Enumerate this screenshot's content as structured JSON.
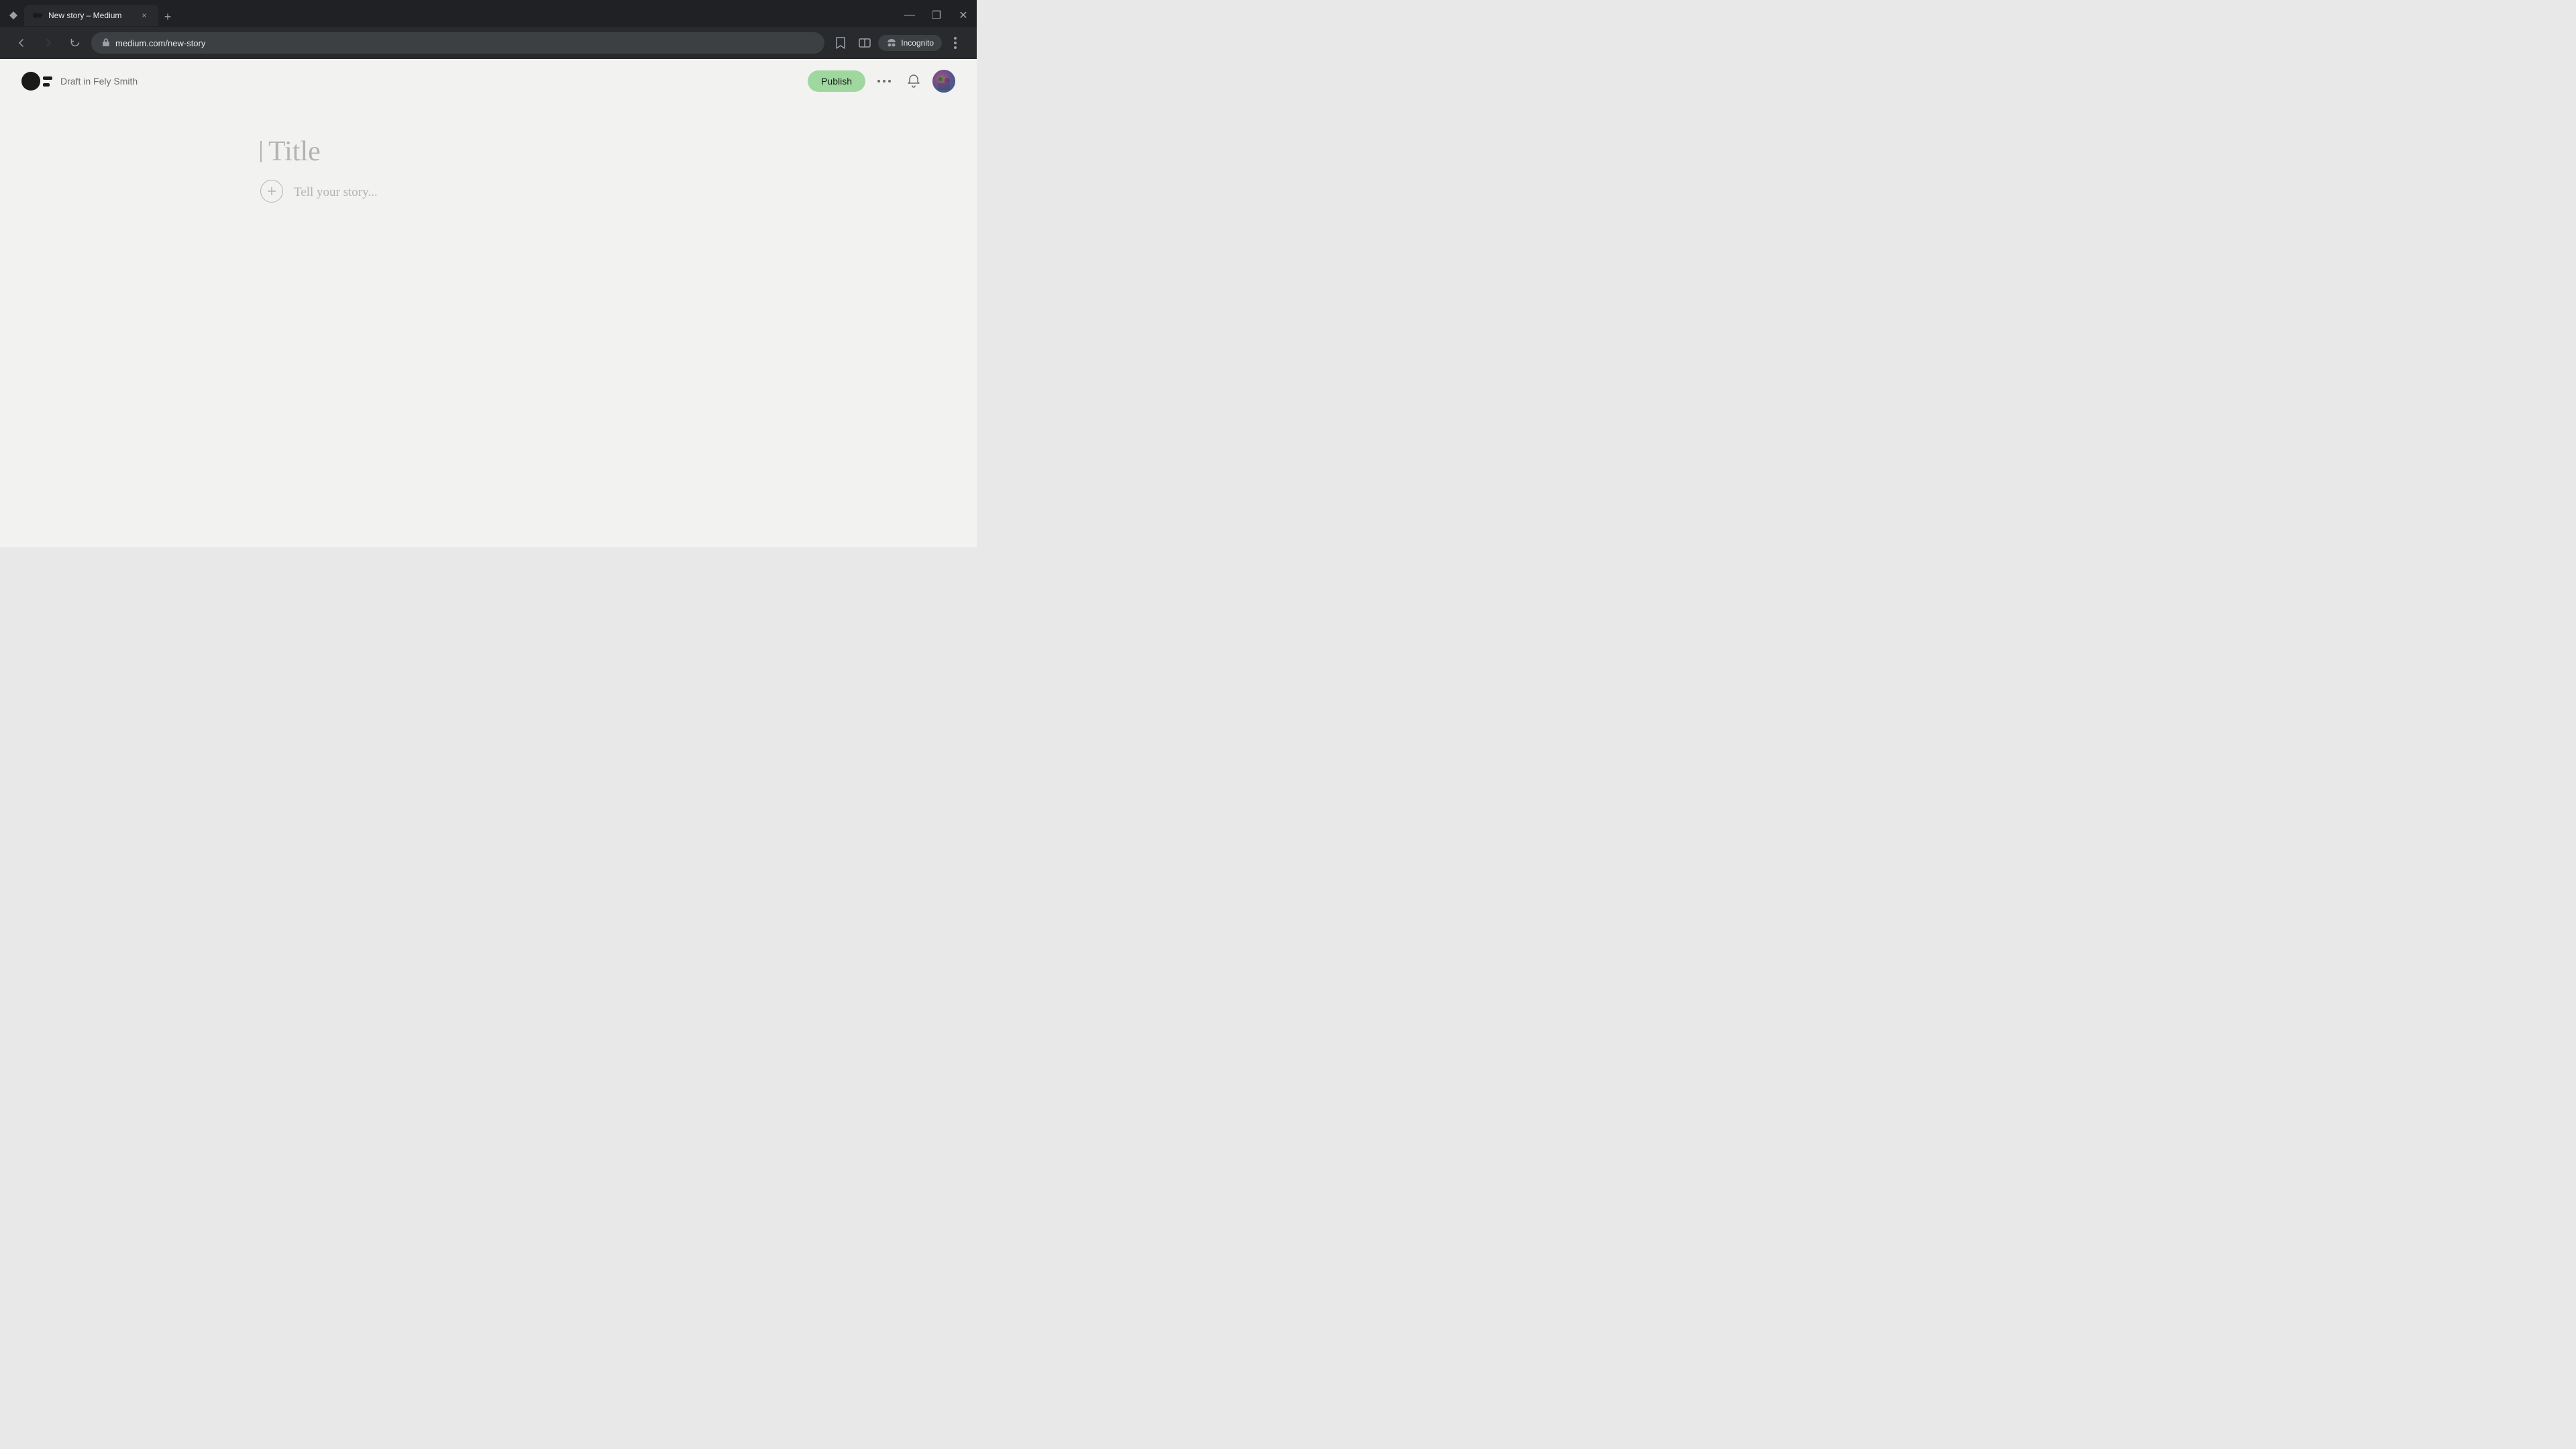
{
  "browser": {
    "tab": {
      "favicon": "M",
      "title": "New story – Medium",
      "close_icon": "×"
    },
    "new_tab_icon": "+",
    "window_controls": {
      "minimize": "—",
      "restore": "❐",
      "close": "✕"
    },
    "nav": {
      "back_icon": "←",
      "forward_icon": "→",
      "reload_icon": "↻",
      "url": "medium.com/new-story",
      "bookmark_icon": "☆",
      "split_icon": "⧉",
      "incognito_label": "Incognito",
      "more_icon": "⋮"
    }
  },
  "medium": {
    "logo_title": "Medium",
    "draft_label": "Draft in Fely Smith",
    "toolbar": {
      "publish_label": "Publish",
      "more_label": "···",
      "notification_icon": "🔔"
    },
    "editor": {
      "title_placeholder": "Title",
      "story_placeholder": "Tell your story...",
      "add_icon": "+"
    }
  }
}
